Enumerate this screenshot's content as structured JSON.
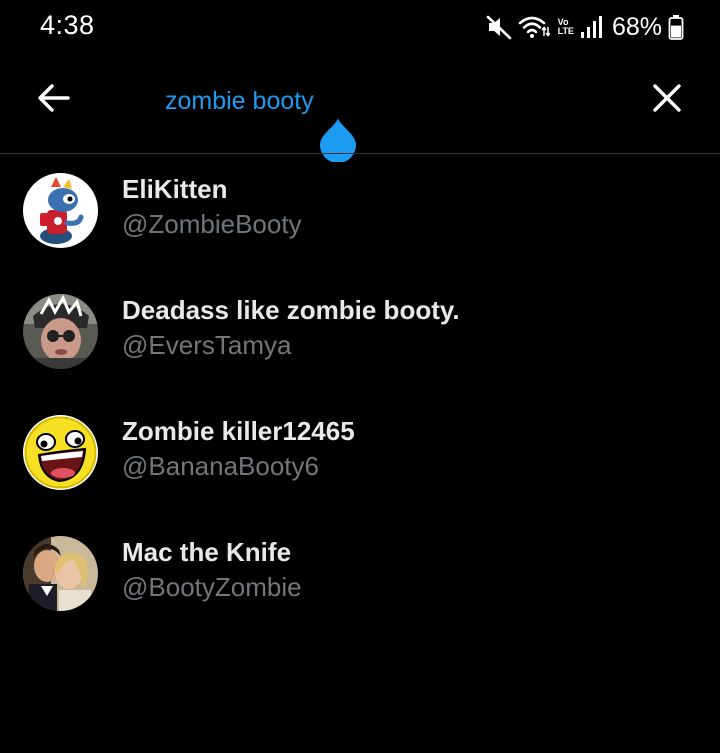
{
  "status_bar": {
    "time": "4:38",
    "volte_top": "Vo",
    "volte_bottom": "LTE",
    "battery_percent": "68%",
    "battery_level": 0.68,
    "icons": [
      "mute-icon",
      "wifi-icon",
      "volte-icon",
      "signal-icon",
      "battery-icon"
    ]
  },
  "search": {
    "query": "zombie booty",
    "accent_color": "#1d9bf0"
  },
  "icons": {
    "back": "arrow-left-icon",
    "clear": "close-icon"
  },
  "results": [
    {
      "name": "EliKitten",
      "handle": "@ZombieBooty"
    },
    {
      "name": "Deadass like zombie booty.",
      "handle": "@EversTamya"
    },
    {
      "name": "Zombie killer12465",
      "handle": "@BananaBooty6"
    },
    {
      "name": "Mac the Knife",
      "handle": "@BootyZombie"
    }
  ],
  "colors": {
    "background": "#000000",
    "name_text": "#e7e9ea",
    "handle_text": "#71767b",
    "divider": "#2f3336"
  }
}
